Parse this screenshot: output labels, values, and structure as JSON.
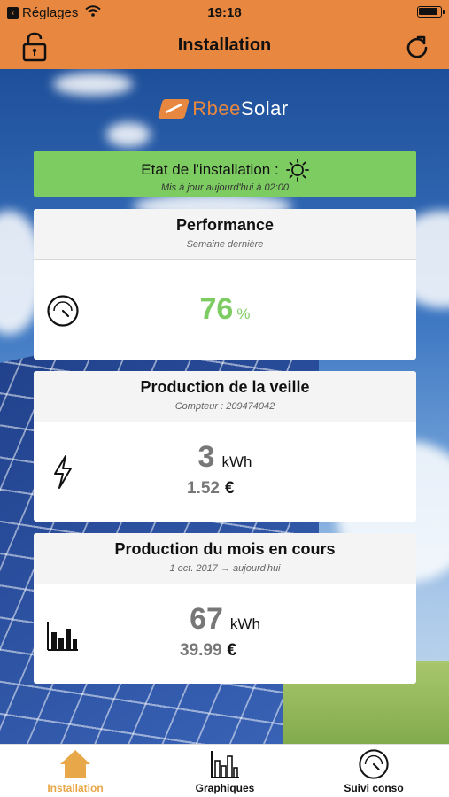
{
  "status_bar": {
    "back_label": "Réglages",
    "time": "19:18"
  },
  "nav": {
    "title": "Installation"
  },
  "brand": {
    "part1": "Rbee",
    "part2": "Solar"
  },
  "state": {
    "title": "Etat de l'installation :",
    "subtitle": "Mis à jour aujourd'hui à 02:00",
    "icon": "sun-icon"
  },
  "performance": {
    "title": "Performance",
    "subtitle": "Semaine dernière",
    "value": "76",
    "unit": "%",
    "icon": "gauge-icon"
  },
  "production_day": {
    "title": "Production de la veille",
    "subtitle": "Compteur : 209474042",
    "energy": "3",
    "energy_unit": "kWh",
    "money": "1.52",
    "currency": "€",
    "icon": "lightning-icon"
  },
  "production_month": {
    "title": "Production du mois en cours",
    "subtitle": "1 oct. 2017 → aujourd'hui",
    "energy": "67",
    "energy_unit": "kWh",
    "money": "39.99",
    "currency": "€",
    "icon": "bar-chart-icon"
  },
  "tabs": [
    {
      "label": "Installation",
      "icon": "home-icon",
      "active": true
    },
    {
      "label": "Graphiques",
      "icon": "graph-icon",
      "active": false
    },
    {
      "label": "Suivi conso",
      "icon": "gauge-icon",
      "active": false
    }
  ],
  "colors": {
    "accent": "#e8873f",
    "good": "#7dcc62",
    "tab_active": "#e8a84a"
  }
}
